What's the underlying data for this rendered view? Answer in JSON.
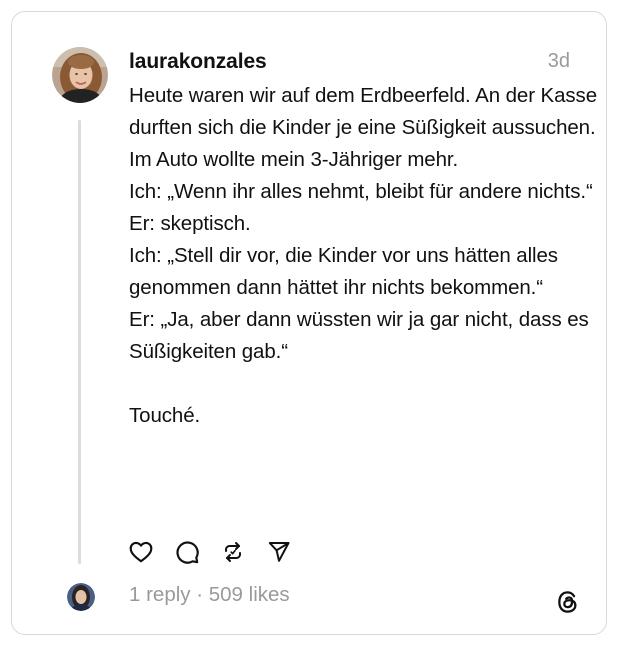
{
  "post": {
    "username": "laurakonzales",
    "timestamp": "3d",
    "body": "Heute waren wir auf dem Erdbeerfeld. An der Kasse durften sich die Kinder je eine Süßigkeit aussuchen. Im Auto wollte mein 3-Jähriger mehr.\nIch: „Wenn ihr alles nehmt, bleibt für andere nichts.“\nEr: skeptisch.\nIch: „Stell dir vor, die Kinder vor uns hätten alles genommen dann hättet ihr nichts bekommen.“\nEr: „Ja, aber dann wüssten wir ja gar nicht, dass es Süßigkeiten gab.“\n\nTouché."
  },
  "actions": {
    "like_icon": "heart-icon",
    "comment_icon": "comment-icon",
    "repost_icon": "repost-icon",
    "share_icon": "send-icon"
  },
  "stats": {
    "replies": "1 reply",
    "separator": " · ",
    "likes": "509 likes"
  },
  "colors": {
    "text": "#111111",
    "muted": "#9a9a9a",
    "border": "#d9d9d9",
    "thread_line": "#dcdcdc"
  },
  "branding": {
    "logo_icon": "threads-logo-icon"
  }
}
